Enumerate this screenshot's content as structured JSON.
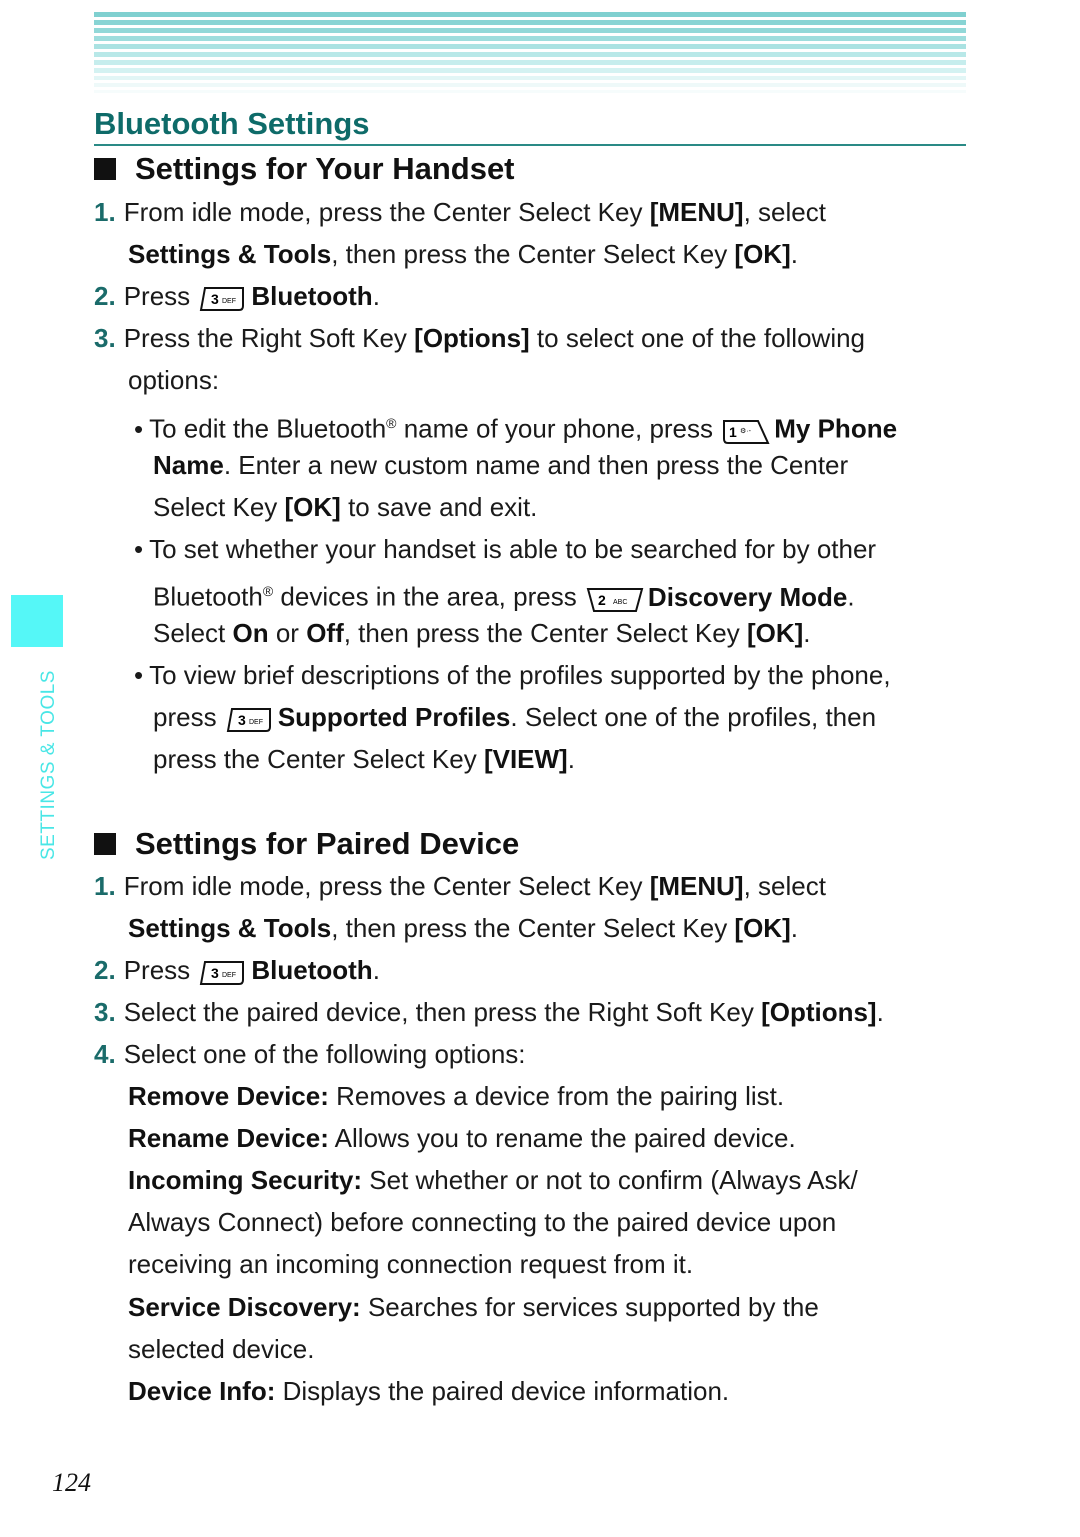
{
  "header": {
    "section_title": "Bluetooth Settings",
    "accent_color": "#0e6b69",
    "stripe_color": "#7fd2d2"
  },
  "sidebar": {
    "chapter_label": "SETTINGS & TOOLS",
    "tab_color": "#55f7f7"
  },
  "handset": {
    "heading": "Settings for Your Handset",
    "steps": [
      {
        "num": "1.",
        "line1_a": "From idle mode, press the Center Select Key ",
        "line1_b": "[MENU]",
        "line1_c": ", select",
        "line2_a": "Settings & Tools",
        "line2_b": ", then press the Center Select Key ",
        "line2_c": "[OK]",
        "line2_d": "."
      },
      {
        "num": "2.",
        "a": "Press ",
        "key": "3 DEF",
        "b": "Bluetooth",
        "c": "."
      },
      {
        "num": "3.",
        "a": "Press the Right Soft Key ",
        "b": "[Options]",
        "c": " to select one of the following",
        "line2": "options:"
      }
    ],
    "bullets": [
      {
        "l1_a": "To edit the Bluetooth",
        "reg": "®",
        "l1_b": " name of your phone, press ",
        "key": "1",
        "l1_c": "My Phone",
        "l2_a": "Name",
        "l2_b": ". Enter a new custom name and then press the Center",
        "l3_a": "Select Key ",
        "l3_b": "[OK]",
        "l3_c": " to save and exit."
      },
      {
        "l1": "To set whether your handset is able to be searched for by other",
        "l2_a": "Bluetooth",
        "reg": "®",
        "l2_b": " devices in the area, press ",
        "key": "2 ABC",
        "l2_c": "Discovery Mode",
        "l2_d": ".",
        "l3_a": "Select ",
        "l3_b": "On",
        "l3_c": " or ",
        "l3_d": "Off",
        "l3_e": ", then press the Center Select Key ",
        "l3_f": "[OK]",
        "l3_g": "."
      },
      {
        "l1": "To view brief descriptions of the profiles supported by the phone,",
        "l2_a": "press ",
        "key": "3 DEF",
        "l2_b": "Supported Profiles",
        "l2_c": ". Select one of the profiles, then",
        "l3_a": "press the Center Select Key ",
        "l3_b": "[VIEW]",
        "l3_c": "."
      }
    ]
  },
  "paired": {
    "heading": "Settings for Paired Device",
    "steps": [
      {
        "num": "1.",
        "line1_a": "From idle mode, press the Center Select Key ",
        "line1_b": "[MENU]",
        "line1_c": ", select",
        "line2_a": "Settings & Tools",
        "line2_b": ", then press the Center Select Key ",
        "line2_c": "[OK]",
        "line2_d": "."
      },
      {
        "num": "2.",
        "a": "Press ",
        "key": "3 DEF",
        "b": "Bluetooth",
        "c": "."
      },
      {
        "num": "3.",
        "a": "Select the paired device, then press the Right Soft Key ",
        "b": "[Options]",
        "c": "."
      },
      {
        "num": "4.",
        "a": "Select one of the following options:"
      }
    ],
    "options": [
      {
        "term": "Remove Device:",
        "desc": " Removes a device from the pairing list."
      },
      {
        "term": "Rename Device:",
        "desc": " Allows you to rename the paired device."
      },
      {
        "term": "Incoming Security:",
        "desc": " Set whether or not to confirm (Always Ask/",
        "desc2": "Always Connect) before connecting to the paired device upon",
        "desc3": "receiving an incoming connection request from it."
      },
      {
        "term": "Service Discovery:",
        "desc": " Searches for services supported by the",
        "desc2": "selected device."
      },
      {
        "term": "Device Info:",
        "desc": " Displays the paired device information."
      }
    ]
  },
  "footer": {
    "page_number": "124"
  }
}
